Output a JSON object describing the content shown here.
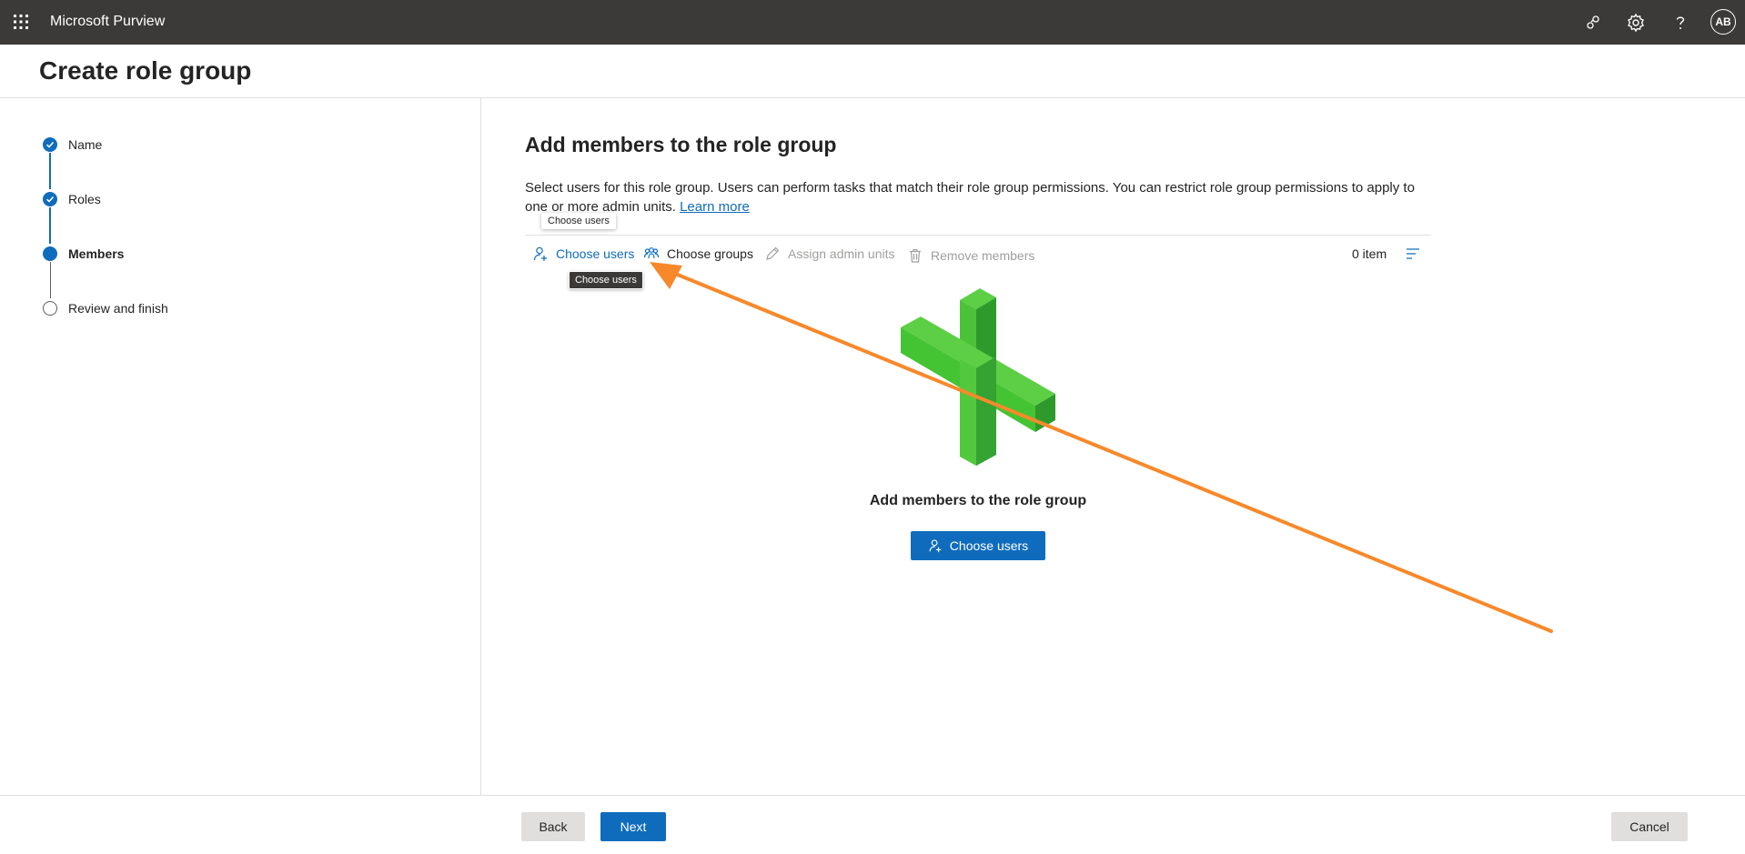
{
  "topbar": {
    "app_title": "Microsoft Purview",
    "avatar_initials": "AB",
    "icons": [
      "waffle-icon",
      "share-icon",
      "settings-icon",
      "help-icon"
    ]
  },
  "page": {
    "title": "Create role group"
  },
  "steps": [
    {
      "label": "Name",
      "state": "completed"
    },
    {
      "label": "Roles",
      "state": "completed"
    },
    {
      "label": "Members",
      "state": "current"
    },
    {
      "label": "Review and finish",
      "state": "pending"
    }
  ],
  "main": {
    "title": "Add members to the role group",
    "description": "Select users for this role group. Users can perform tasks that match their role group permissions. You can restrict role group permissions to apply to one or more admin units.",
    "learn_more": "Learn more"
  },
  "toolbar": {
    "choose_users": "Choose users",
    "choose_groups": "Choose groups",
    "assign_admin_units": "Assign admin units",
    "remove_members": "Remove members",
    "item_count": "0 item"
  },
  "tooltips": {
    "light": "Choose users",
    "dark": "Choose users"
  },
  "empty_state": {
    "title": "Add members to the role group",
    "button": "Choose users"
  },
  "footer": {
    "back": "Back",
    "next": "Next",
    "cancel": "Cancel"
  },
  "colors": {
    "accent": "#0f6cbd",
    "topbar": "#3b3a39",
    "annotation_arrow": "#f7892b",
    "illustration_green": "#4cc23a"
  }
}
